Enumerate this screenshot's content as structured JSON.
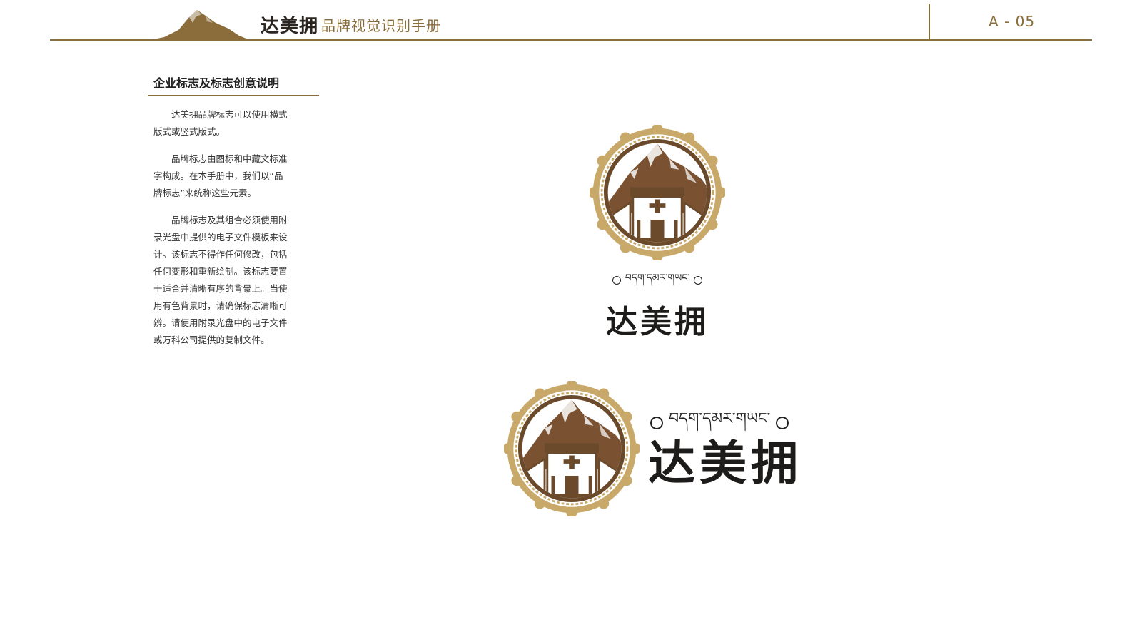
{
  "header": {
    "brand_name": "达美拥",
    "manual_title": "品牌视觉识别手册",
    "page_number": "A - 05"
  },
  "sidebar": {
    "section_title": "企业标志及标志创意说明",
    "paragraphs": [
      "达美拥品牌标志可以使用横式版式或竖式版式。",
      "品牌标志由图标和中藏文标准字构成。在本手册中，我们以“品牌标志”来统称这些元素。",
      "品牌标志及其组合必须使用附录光盘中提供的电子文件模板来设计。该标志不得作任何修改，包括任何变形和重新绘制。该标志要置于适合并清晰有序的背景上。当使用有色背景时，请确保标志清晰可辨。请使用附录光盘中的电子文件或万科公司提供的复制文件。"
    ]
  },
  "logos": {
    "vertical": {
      "tibetan_text": "བདག་དམར་གཡང་",
      "chinese_text": "达美拥"
    },
    "horizontal": {
      "tibetan_text": "བདག་དམར་གཡང་",
      "chinese_text": "达美拥"
    }
  },
  "colors": {
    "brand_brown": "#8a6d3b",
    "gold": "#c8a96a",
    "dark_brown": "#6b4a2b",
    "text_dark": "#1e1c1a"
  },
  "icons": [
    "mountain-icon",
    "emblem-icon"
  ]
}
